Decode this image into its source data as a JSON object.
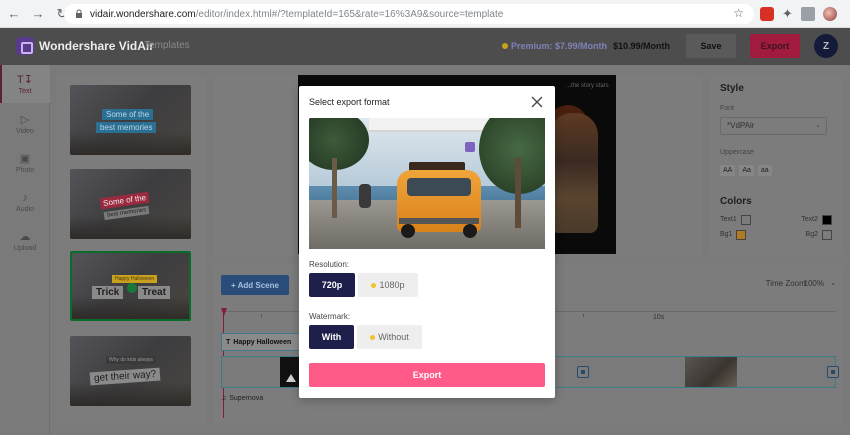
{
  "browser": {
    "url_host": "vidair.wondershare.com",
    "url_path": "/editor/index.html#/?templateId=165&rate=16%3A9&source=template"
  },
  "header": {
    "app_name": "Wondershare VidAir",
    "templates_link": "Templates",
    "premium_label": "Premium: $7.99/Month",
    "premium_original": "$10.99/Month",
    "save_label": "Save",
    "export_label": "Export",
    "user_initial": "Z"
  },
  "rail": {
    "items": [
      {
        "label": "Text",
        "icon": "text-icon"
      },
      {
        "label": "Video",
        "icon": "video-icon"
      },
      {
        "label": "Photo",
        "icon": "photo-icon"
      },
      {
        "label": "Audio",
        "icon": "audio-icon"
      },
      {
        "label": "Upload",
        "icon": "upload-icon"
      }
    ]
  },
  "templates": {
    "t1_line1": "Some of the",
    "t1_line2": "best memories",
    "t2_line1": "Some of the",
    "t2_line2": "best memories",
    "t3_small": "Happy Halloween",
    "t3_trick": "Trick",
    "t3_treat": "Treat",
    "t4_small": "Why do kids always",
    "t4_main": "get their way?"
  },
  "preview": {
    "story_text": "...the story\nstars"
  },
  "style_panel": {
    "title": "Style",
    "font_label": "Font",
    "font_value": "*VdPAir",
    "uppercase_label": "Uppercase",
    "uppercase_options": [
      "AA",
      "Aa",
      "aa"
    ],
    "colors_title": "Colors",
    "colors": [
      {
        "label": "Text1",
        "color": "#7c7c7c"
      },
      {
        "label": "Text2",
        "color": "#000000"
      },
      {
        "label": "Bg1",
        "color": "#b07a20"
      },
      {
        "label": "Bg2",
        "color": "#7c7c7c"
      }
    ]
  },
  "timeline": {
    "add_scene": "+ Add Scene",
    "time_zoom_label": "Time Zoom:",
    "time_zoom_value": "100%",
    "ruler_label": "10s",
    "text_clip": "Happy Halloween",
    "audio_clip": "Supernova"
  },
  "modal": {
    "title": "Select export format",
    "resolution_label": "Resolution:",
    "res_720": "720p",
    "res_1080": "1080p",
    "watermark_label": "Watermark:",
    "wm_with": "With",
    "wm_without": "Without",
    "export_button": "Export"
  }
}
